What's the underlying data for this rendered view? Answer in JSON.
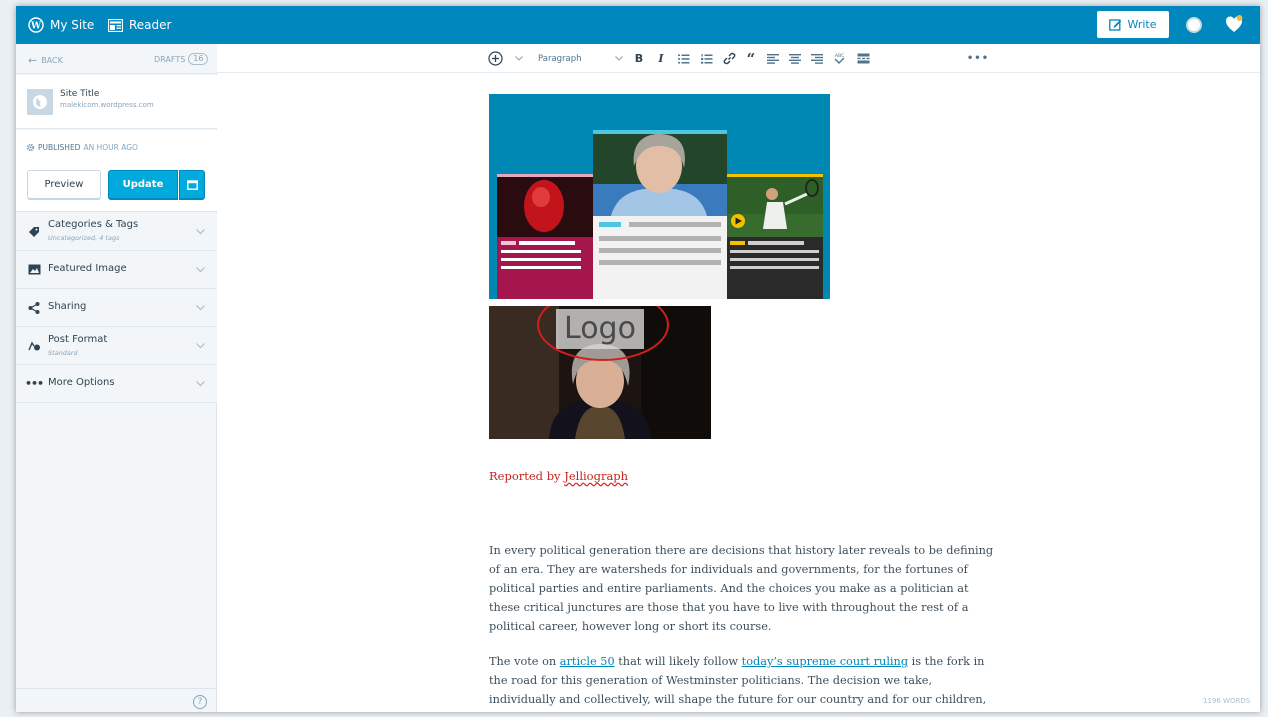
{
  "masterbar": {
    "my_site": "My Site",
    "reader": "Reader",
    "write": "Write"
  },
  "sidebar": {
    "back": "BACK",
    "drafts_label": "DRAFTS",
    "drafts_count": "16",
    "site": {
      "title": "Site Title",
      "url": "malekicom.wordpress.com"
    },
    "publish": {
      "status_strong": "PUBLISHED",
      "status_rest": "AN HOUR AGO",
      "preview": "Preview",
      "update": "Update"
    },
    "accordions": [
      {
        "title": "Categories & Tags",
        "subtitle": "Uncategorized, 4 tags",
        "icon": "tag-icon"
      },
      {
        "title": "Featured Image",
        "subtitle": "",
        "icon": "image-icon"
      },
      {
        "title": "Sharing",
        "subtitle": "",
        "icon": "share-icon"
      },
      {
        "title": "Post Format",
        "subtitle": "Standard",
        "icon": "post-format-icon"
      },
      {
        "title": "More Options",
        "subtitle": "",
        "icon": "ellipsis-icon"
      }
    ]
  },
  "toolbar": {
    "block_format": "Paragraph",
    "buttons": [
      "add-icon",
      "bold-icon",
      "italic-icon",
      "bullet-list-icon",
      "numbered-list-icon",
      "link-icon",
      "blockquote-icon",
      "align-left-icon",
      "align-center-icon",
      "align-right-icon",
      "spellcheck-icon",
      "read-more-icon",
      "more-icon"
    ]
  },
  "post": {
    "image2_overlay_text": "Logo",
    "byline_prefix": "Reported by ",
    "byline_link": "Jelliograph",
    "paragraphs": [
      {
        "text": "In every political generation there are decisions that history later reveals to be defining of an era. They are watersheds for individuals and governments, for the fortunes of political parties and entire parliaments. And the choices you make as a politician at these critical junctures are those that you have to live with throughout the rest of a political career, however long or short its course."
      },
      {
        "before": "The vote on ",
        "link1": "article 50",
        "middle": " that will likely follow ",
        "link2": "today’s supreme court ruling",
        "after": " is the fork in the road for this generation of Westminster politicians. The decision we take, individually and collectively, will shape the future for our country and for our children, and it may also determine the fate of the current crop of MPs and the parties we represent."
      }
    ]
  },
  "word_count": "1196 WORDS",
  "colors": {
    "masterbar": "#0087be",
    "accent": "#00aadc",
    "sidebar_bg": "#f3f6f8",
    "byline": "#c4241b",
    "annotation_circle": "#d41e1e"
  }
}
